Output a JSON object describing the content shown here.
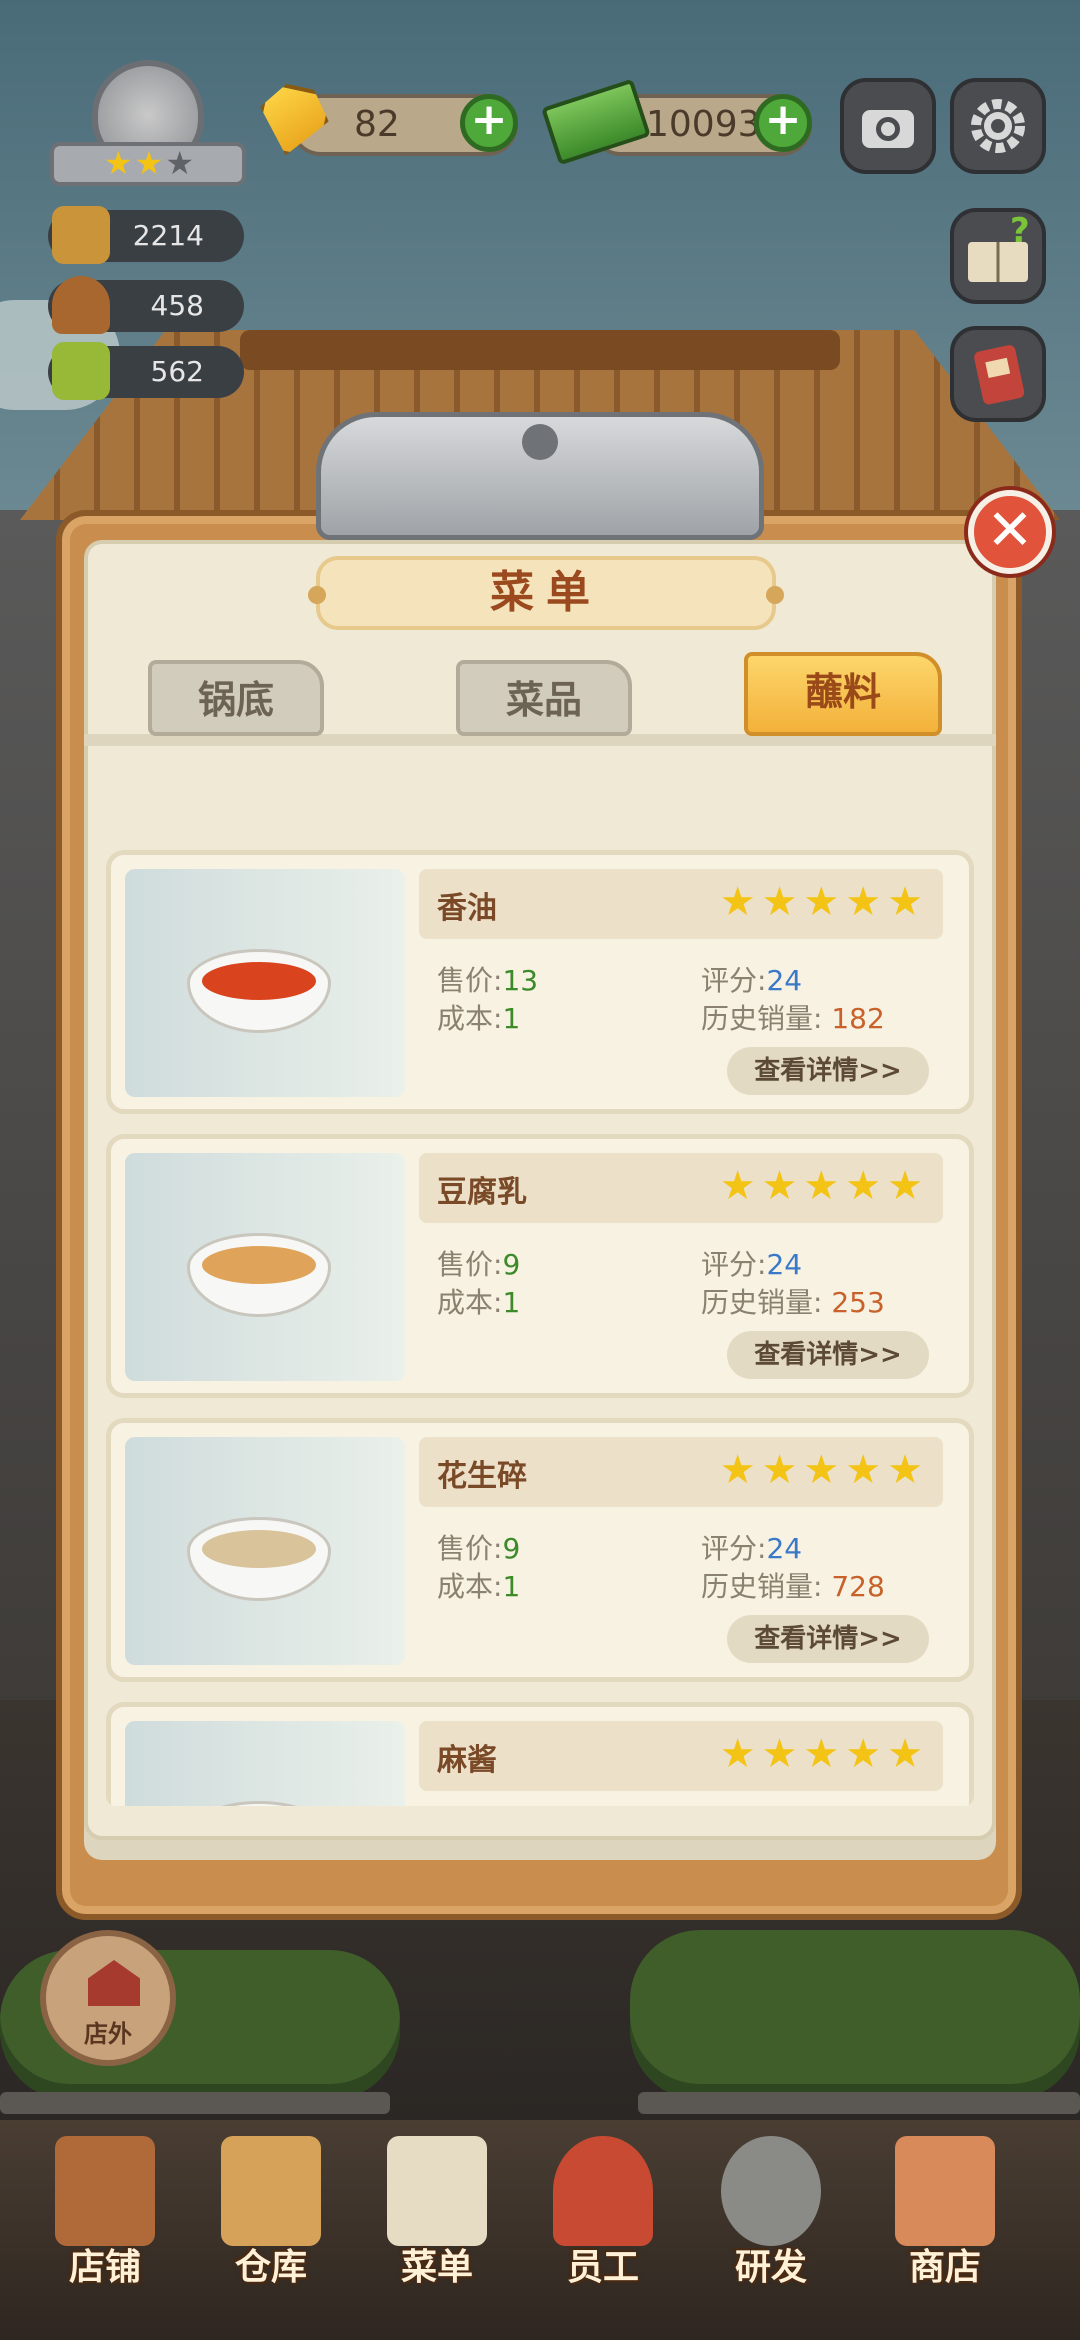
{
  "hud": {
    "rating_stars": [
      "★",
      "★",
      "★"
    ],
    "gems": "82",
    "cash": "10093",
    "stats": [
      {
        "icon": "table-icon",
        "value": "2214"
      },
      {
        "icon": "serving-tray-icon",
        "value": "458"
      },
      {
        "icon": "menu-book-icon",
        "value": "562"
      }
    ],
    "plus": "+"
  },
  "panel": {
    "title": "菜单",
    "close": "✕",
    "tabs": [
      {
        "label": "锅底",
        "active": false
      },
      {
        "label": "菜品",
        "active": false
      },
      {
        "label": "蘸料",
        "active": true
      }
    ]
  },
  "items": [
    {
      "name": "香油",
      "stars": "★★★★★",
      "price_label": "售价:",
      "price": "13",
      "rating_label": "评分:",
      "rating": "24",
      "cost_label": "成本:",
      "cost": "1",
      "sales_label": "历史销量:",
      "sales": "182",
      "detail": "查看详情>>",
      "color": "#d9441e"
    },
    {
      "name": "豆腐乳",
      "stars": "★★★★★",
      "price_label": "售价:",
      "price": "9",
      "rating_label": "评分:",
      "rating": "24",
      "cost_label": "成本:",
      "cost": "1",
      "sales_label": "历史销量:",
      "sales": "253",
      "detail": "查看详情>>",
      "color": "#e0a35a"
    },
    {
      "name": "花生碎",
      "stars": "★★★★★",
      "price_label": "售价:",
      "price": "9",
      "rating_label": "评分:",
      "rating": "24",
      "cost_label": "成本:",
      "cost": "1",
      "sales_label": "历史销量:",
      "sales": "728",
      "detail": "查看详情>>",
      "color": "#d8c39a"
    },
    {
      "name": "麻酱",
      "stars": "★★★★★",
      "color": "#c98a3a"
    }
  ],
  "outside_label": "店外",
  "nav": [
    {
      "label": "店铺",
      "icon": "shop-building-icon"
    },
    {
      "label": "仓库",
      "icon": "warehouse-boxes-icon"
    },
    {
      "label": "菜单",
      "icon": "clipboard-menu-icon"
    },
    {
      "label": "员工",
      "icon": "staff-waitress-icon"
    },
    {
      "label": "研发",
      "icon": "research-wok-icon"
    },
    {
      "label": "商店",
      "icon": "store-stall-icon"
    }
  ]
}
